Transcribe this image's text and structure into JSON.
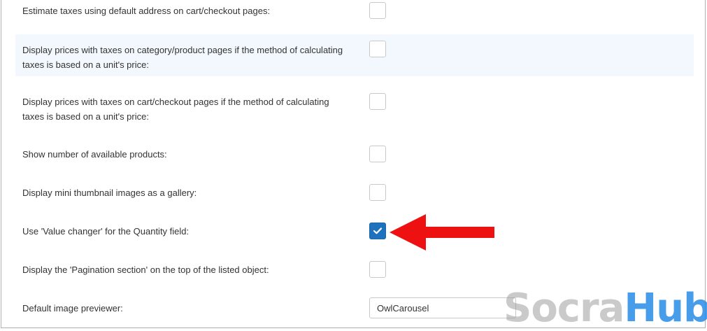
{
  "settings": [
    {
      "label": "Estimate taxes using default address on cart/checkout pages:",
      "checked": false
    },
    {
      "label": "Display prices with taxes on category/product pages if the method of calculating taxes is based on a unit's price:",
      "checked": false
    },
    {
      "label": "Display prices with taxes on cart/checkout pages if the method of calculating taxes is based on a unit's price:",
      "checked": false
    },
    {
      "label": "Show number of available products:",
      "checked": false
    },
    {
      "label": "Display mini thumbnail images as a gallery:",
      "checked": false
    },
    {
      "label": "Use 'Value changer' for the Quantity field:",
      "checked": true
    },
    {
      "label": "Display the 'Pagination section' on the top of the listed object:",
      "checked": false
    }
  ],
  "image_previewer": {
    "label": "Default image previewer:",
    "selected": "OwlCarousel"
  },
  "annotation": {
    "arrow_color": "#ee1111",
    "points_to": "Use 'Value changer' for the Quantity field"
  },
  "watermark": {
    "part1": "Socra",
    "part2": "Hub"
  },
  "colors": {
    "checkbox_checked": "#1e72bd",
    "row_highlight": "#f2f8fd"
  }
}
